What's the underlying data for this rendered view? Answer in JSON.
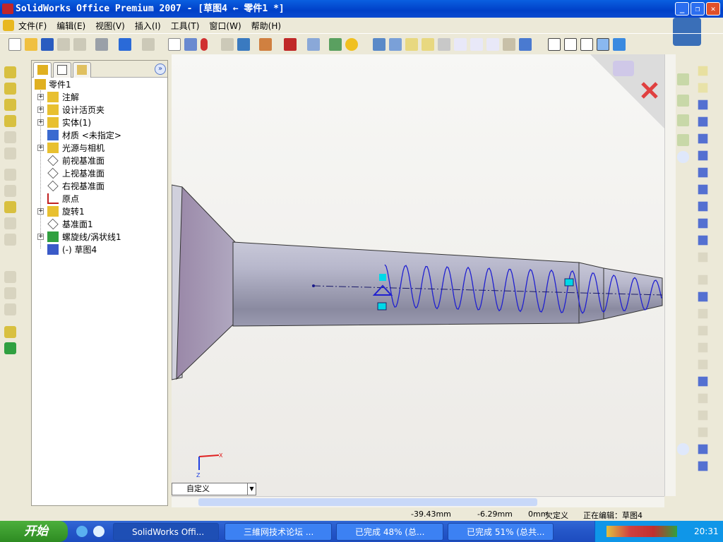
{
  "window": {
    "title": "SolidWorks Office Premium 2007 - [草图4 ← 零件1 *]",
    "icon": "solidworks-logo-icon",
    "controls": [
      "minimize",
      "restore",
      "close"
    ]
  },
  "menu": [
    "文件(F)",
    "编辑(E)",
    "视图(V)",
    "插入(I)",
    "工具(T)",
    "窗口(W)",
    "帮助(H)"
  ],
  "feature_tree": {
    "root": "零件1",
    "items": [
      {
        "label": "注解",
        "icon": "annotations-icon",
        "expandable": true
      },
      {
        "label": "设计活页夹",
        "icon": "design-binder-icon",
        "expandable": true
      },
      {
        "label": "实体(1)",
        "icon": "solid-bodies-icon",
        "expandable": true
      },
      {
        "label": "材质 <未指定>",
        "icon": "material-icon",
        "expandable": false
      },
      {
        "label": "光源与相机",
        "icon": "lights-cameras-icon",
        "expandable": true
      },
      {
        "label": "前视基准面",
        "icon": "plane-icon",
        "expandable": false
      },
      {
        "label": "上视基准面",
        "icon": "plane-icon",
        "expandable": false
      },
      {
        "label": "右视基准面",
        "icon": "plane-icon",
        "expandable": false
      },
      {
        "label": "原点",
        "icon": "origin-icon",
        "expandable": false
      },
      {
        "label": "旋转1",
        "icon": "revolve-icon",
        "expandable": true
      },
      {
        "label": "基准面1",
        "icon": "plane-icon",
        "expandable": false
      },
      {
        "label": "螺旋线/涡状线1",
        "icon": "helix-icon",
        "expandable": true
      },
      {
        "label": "(-) 草图4",
        "icon": "sketch-icon",
        "expandable": false
      }
    ]
  },
  "viewport": {
    "view_select": "自定义",
    "axis_x": "X",
    "axis_z": "Z",
    "colors": {
      "helix": "#2020d0",
      "body": "#a8a8c0",
      "selection": "#00d8e8"
    }
  },
  "status": {
    "x": "-39.43mm",
    "y": "-6.29mm",
    "z": "0mm",
    "state": "欠定义",
    "editing": "正在编辑：草图4"
  },
  "taskbar": {
    "start": "开始",
    "tasks": [
      "SolidWorks Offi...",
      "三維网技术论坛 ...",
      "已完成 48% (总...",
      "已完成 51% (总共..."
    ],
    "clock": "20:31"
  }
}
